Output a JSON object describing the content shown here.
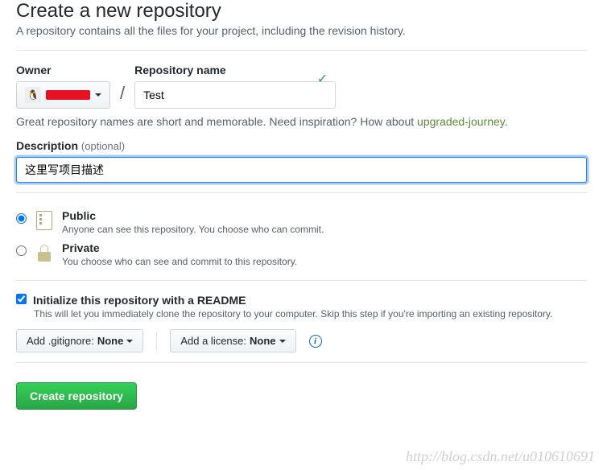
{
  "header": {
    "title": "Create a new repository",
    "subtitle": "A repository contains all the files for your project, including the revision history."
  },
  "owner": {
    "label": "Owner",
    "avatar_glyph": "🐧"
  },
  "repo": {
    "label": "Repository name",
    "value": "Test"
  },
  "hint": {
    "prefix": "Great repository names are short and memorable. Need inspiration? How about ",
    "suggestion": "upgraded-journey",
    "suffix": "."
  },
  "description": {
    "label": "Description",
    "optional": "(optional)",
    "value": "这里写项目描述"
  },
  "visibility": {
    "public": {
      "title": "Public",
      "desc": "Anyone can see this repository. You choose who can commit."
    },
    "private": {
      "title": "Private",
      "desc": "You choose who can see and commit to this repository."
    }
  },
  "init": {
    "label": "Initialize this repository with a README",
    "desc": "This will let you immediately clone the repository to your computer. Skip this step if you're importing an existing repository."
  },
  "dropdowns": {
    "gitignore_prefix": "Add .gitignore: ",
    "gitignore_value": "None",
    "license_prefix": "Add a license: ",
    "license_value": "None"
  },
  "submit": {
    "label": "Create repository"
  },
  "watermark": "http://blog.csdn.net/u010610691"
}
